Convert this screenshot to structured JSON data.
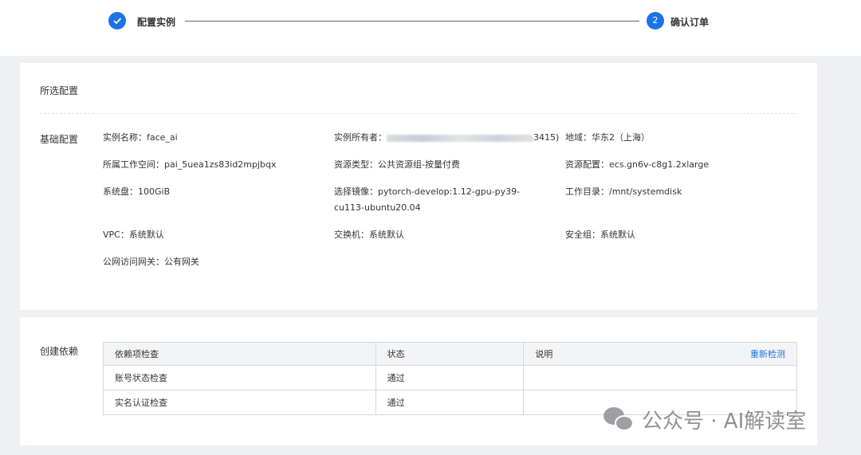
{
  "steps": {
    "step1": {
      "label": "配置实例",
      "state": "done"
    },
    "step2": {
      "number": "2",
      "label": "确认订单",
      "state": "current"
    }
  },
  "selected_config": {
    "title": "所选配置",
    "group_label": "基础配置",
    "fields": {
      "instance_name": "实例名称：face_ai",
      "owner_key": "实例所有者：",
      "owner_suffix": "3415)",
      "region": "地域：华东2（上海）",
      "workspace": "所属工作空间：pai_5uea1zs83id2mpjbqx",
      "resource_type": "资源类型：公共资源组-按量付费",
      "resource_spec": "资源配置：ecs.gn6v-c8g1.2xlarge",
      "system_disk": "系统盘：100GiB",
      "image": "选择镜像：pytorch-develop:1.12-gpu-py39-cu113-ubuntu20.04",
      "work_dir": "工作目录：/mnt/systemdisk",
      "vpc": "VPC：系统默认",
      "switch": "交换机：系统默认",
      "security_group": "安全组：系统默认",
      "public_gateway": "公网访问网关：公有网关"
    }
  },
  "dependencies": {
    "label": "创建依赖",
    "headers": {
      "item": "依赖项检查",
      "status": "状态",
      "desc": "说明"
    },
    "recheck": "重新检测",
    "rows": [
      {
        "item": "账号状态检查",
        "status": "通过",
        "desc": ""
      },
      {
        "item": "实名认证检查",
        "status": "通过",
        "desc": ""
      }
    ]
  },
  "watermark": {
    "text": "公众号 · AI解读室",
    "icon": "wechat-icon"
  },
  "colors": {
    "accent": "#1a73e8",
    "pass": "#2e9b33",
    "page_bg": "#eff0f3"
  }
}
